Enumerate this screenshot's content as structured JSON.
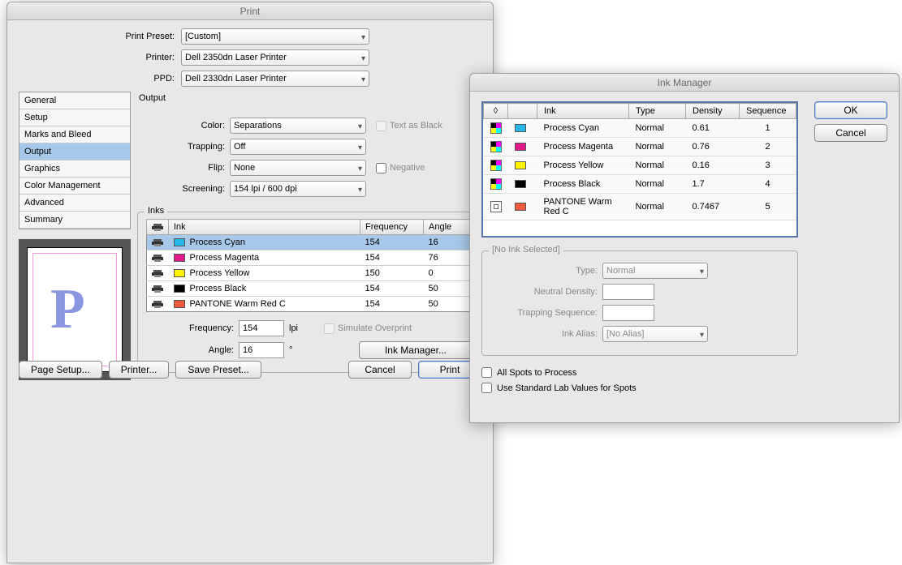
{
  "print": {
    "title": "Print",
    "labels": {
      "preset": "Print Preset:",
      "printer": "Printer:",
      "ppd": "PPD:"
    },
    "preset": "[Custom]",
    "printer": "Dell 2350dn Laser Printer",
    "ppd": "Dell 2330dn Laser Printer",
    "sidebar": [
      "General",
      "Setup",
      "Marks and Bleed",
      "Output",
      "Graphics",
      "Color Management",
      "Advanced",
      "Summary"
    ],
    "selected_sidebar": 3,
    "section_header": "Output",
    "output": {
      "color_label": "Color:",
      "color_value": "Separations",
      "text_as_black": "Text as Black",
      "trapping_label": "Trapping:",
      "trapping_value": "Off",
      "flip_label": "Flip:",
      "flip_value": "None",
      "negative": "Negative",
      "screening_label": "Screening:",
      "screening_value": "154 lpi / 600 dpi"
    },
    "inks_legend": "Inks",
    "inks_headers": {
      "blank": "",
      "ink": "Ink",
      "frequency": "Frequency",
      "angle": "Angle"
    },
    "inks": [
      {
        "name": "Process Cyan",
        "color": "#26b7ea",
        "frequency": "154",
        "angle": "16"
      },
      {
        "name": "Process Magenta",
        "color": "#e21b8b",
        "frequency": "154",
        "angle": "76"
      },
      {
        "name": "Process Yellow",
        "color": "#fff200",
        "frequency": "150",
        "angle": "0"
      },
      {
        "name": "Process Black",
        "color": "#000000",
        "frequency": "154",
        "angle": "50"
      },
      {
        "name": "PANTONE Warm Red C",
        "color": "#f25b3f",
        "frequency": "154",
        "angle": "50"
      }
    ],
    "freq_label": "Frequency:",
    "freq_value": "154",
    "freq_unit": "lpi",
    "angle_label": "Angle:",
    "angle_value": "16",
    "angle_unit": "°",
    "simulate": "Simulate Overprint",
    "ink_manager_btn": "Ink Manager...",
    "bottom": {
      "page_setup": "Page Setup...",
      "printer_btn": "Printer...",
      "save_preset": "Save Preset...",
      "cancel": "Cancel",
      "print": "Print"
    }
  },
  "inkmgr": {
    "title": "Ink Manager",
    "ok": "OK",
    "cancel": "Cancel",
    "headers": {
      "icon1": "",
      "icon2": "",
      "ink": "Ink",
      "type": "Type",
      "density": "Density",
      "sequence": "Sequence"
    },
    "rows": [
      {
        "kind": "process",
        "name": "Process Cyan",
        "color": "#26b7ea",
        "type": "Normal",
        "density": "0.61",
        "sequence": "1"
      },
      {
        "kind": "process",
        "name": "Process Magenta",
        "color": "#e21b8b",
        "type": "Normal",
        "density": "0.76",
        "sequence": "2"
      },
      {
        "kind": "process",
        "name": "Process Yellow",
        "color": "#fff200",
        "type": "Normal",
        "density": "0.16",
        "sequence": "3"
      },
      {
        "kind": "process",
        "name": "Process Black",
        "color": "#000000",
        "type": "Normal",
        "density": "1.7",
        "sequence": "4"
      },
      {
        "kind": "spot",
        "name": "PANTONE Warm Red C",
        "color": "#f25b3f",
        "type": "Normal",
        "density": "0.7467",
        "sequence": "5"
      }
    ],
    "fs_legend": "[No Ink Selected]",
    "type_label": "Type:",
    "type_value": "Normal",
    "nd_label": "Neutral Density:",
    "ts_label": "Trapping Sequence:",
    "alias_label": "Ink Alias:",
    "alias_value": "[No Alias]",
    "spots_to_process": "All Spots to Process",
    "lab_values": "Use Standard Lab Values for Spots"
  }
}
